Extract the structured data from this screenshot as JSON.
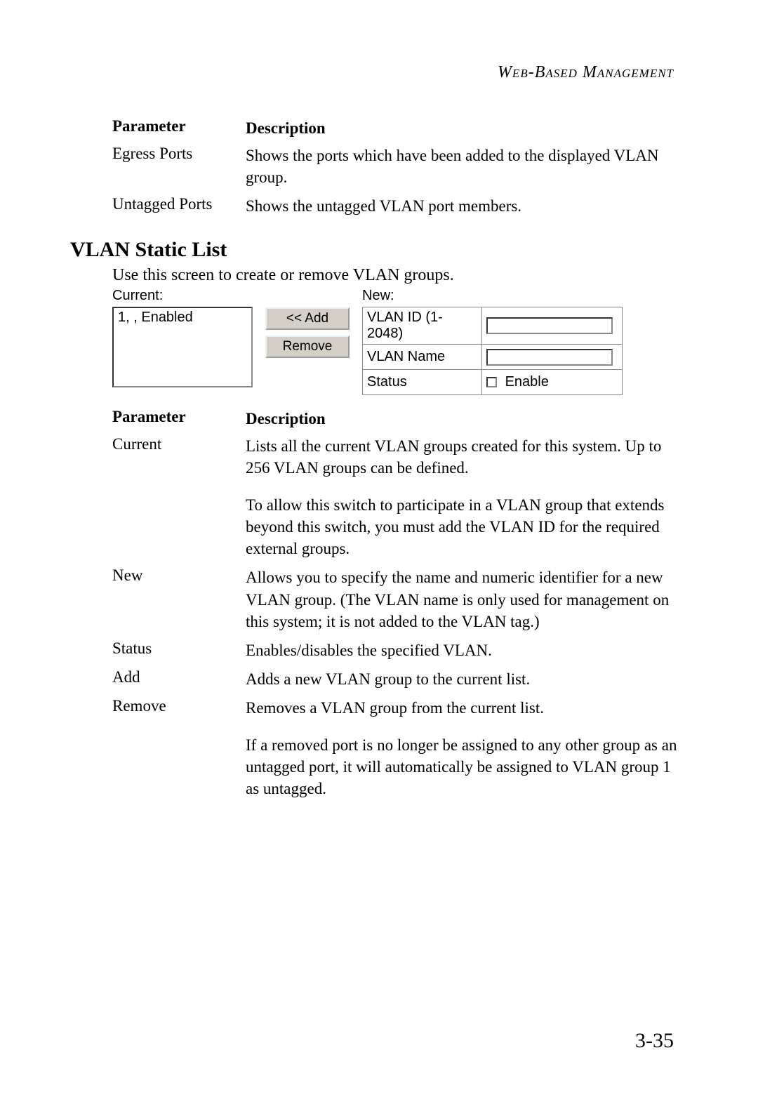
{
  "running_head": "Web-Based Management",
  "page_number": "3-35",
  "table1": {
    "header_param": "Parameter",
    "header_desc": "Description",
    "rows": [
      {
        "param": "Egress Ports",
        "desc": "Shows the ports which have been added to the displayed VLAN group."
      },
      {
        "param": "Untagged Ports",
        "desc": "Shows the untagged VLAN port members."
      }
    ]
  },
  "section": {
    "heading": "VLAN Static List",
    "intro": "Use this screen to create or remove VLAN groups."
  },
  "ui": {
    "current_label": "Current:",
    "current_item": "1, , Enabled",
    "add_button": "<< Add",
    "remove_button": "Remove",
    "new_label": "New:",
    "vlan_id_label": "VLAN ID (1-2048)",
    "vlan_name_label": "VLAN Name",
    "status_label": "Status",
    "enable_label": "Enable"
  },
  "table2": {
    "header_param": "Parameter",
    "header_desc": "Description",
    "rows": [
      {
        "param": "Current",
        "desc": "Lists all the current VLAN groups created for this system. Up to 256 VLAN groups can be defined."
      },
      {
        "param": "",
        "desc": "To allow this switch to participate in a VLAN group that extends beyond this switch, you must add the VLAN ID for the required external groups."
      },
      {
        "param": "New",
        "desc": "Allows you to specify the name and numeric identifier for a new VLAN group. (The VLAN name is only used for management on this system; it is not added to the VLAN tag.)"
      },
      {
        "param": "Status",
        "desc": "Enables/disables the specified VLAN."
      },
      {
        "param": "Add",
        "desc": "Adds a new VLAN group to the current list."
      },
      {
        "param": "Remove",
        "desc": "Removes a VLAN group from the current list."
      },
      {
        "param": "",
        "desc": "If a removed port is no longer be assigned to any other group as an untagged port, it will automatically be assigned to VLAN group 1 as untagged."
      }
    ]
  }
}
